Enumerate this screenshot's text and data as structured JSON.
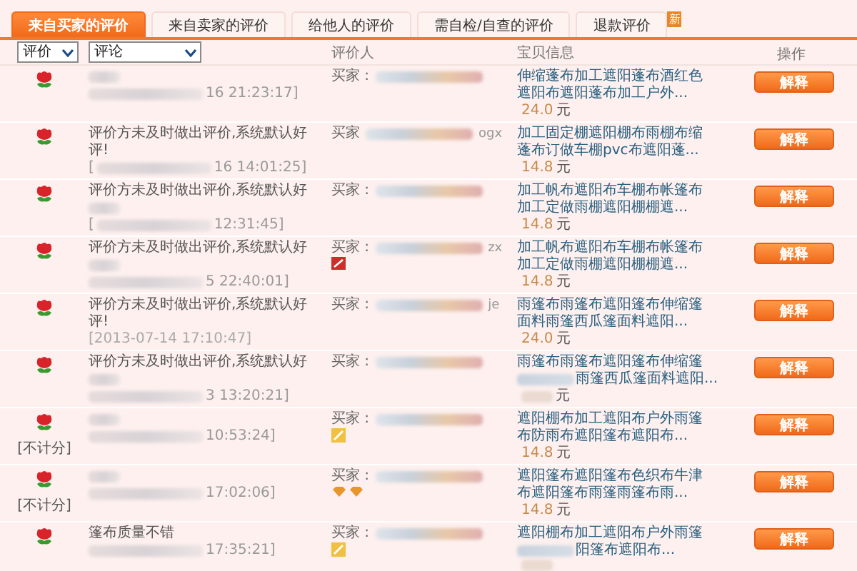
{
  "tabs": [
    {
      "label": "来自买家的评价",
      "selected": true
    },
    {
      "label": "来自卖家的评价",
      "selected": false
    },
    {
      "label": "给他人的评价",
      "selected": false
    },
    {
      "label": "需自检/自查的评价",
      "selected": false
    },
    {
      "label": "退款评价",
      "selected": false,
      "badge": "新"
    }
  ],
  "filters": [
    {
      "value": "评价"
    },
    {
      "value": "评论"
    }
  ],
  "columns": [
    "评价人",
    "宝贝信息",
    "操作"
  ],
  "rows": [
    {
      "comment_blurred": true,
      "time": "16 21:23:17]",
      "buyer_label": "买家 :",
      "item_lines": [
        {
          "text": "伸缩蓬布加工遮阳蓬布酒红色"
        },
        {
          "text": "遮阳布遮阳蓬布加工户外..."
        }
      ],
      "price": "24.0",
      "currency": "元",
      "action": "解释"
    },
    {
      "comment": "评价方未及时做出评价,系统默认好评!",
      "time_lead": "[",
      "time": "16 14:01:25]",
      "buyer_label": "买家",
      "buyer_visible": "ogx",
      "item_lines": [
        {
          "text": "加工固定棚遮阳棚布雨棚布缩"
        },
        {
          "text": "蓬布订做车棚pvc布遮阳蓬..."
        }
      ],
      "price": "14.8",
      "currency": "元",
      "action": "解释"
    },
    {
      "comment": "评价方未及时做出评价,系统默认好",
      "comment_blurred": true,
      "time_lead": "[",
      "time": "12:31:45]",
      "buyer_label": "买家 :",
      "item_lines": [
        {
          "text": "加工帆布遮阳布车棚布帐篷布"
        },
        {
          "text": "加工定做雨棚遮阳棚棚遮..."
        }
      ],
      "price": "14.8",
      "currency": "元",
      "action": "解释"
    },
    {
      "comment": "评价方未及时做出评价,系统默认好",
      "comment_blurred": true,
      "time": "5 22:40:01]",
      "buyer_label": "买家 :",
      "buyer_visible": "zx",
      "badge": {
        "kind": "flag"
      },
      "item_lines": [
        {
          "text": "加工帆布遮阳布车棚布帐篷布"
        },
        {
          "text": "加工定做雨棚遮阳棚棚遮..."
        }
      ],
      "price": "14.8",
      "currency": "元",
      "action": "解释"
    },
    {
      "comment": "评价方未及时做出评价,系统默认好评!",
      "time": "[2013-07-14 17:10:47]",
      "time_full": true,
      "buyer_label": "买家 :",
      "buyer_visible": "je",
      "item_lines": [
        {
          "text": "雨篷布雨篷布遮阳篷布伸缩篷"
        },
        {
          "text": "面料雨篷西瓜篷面料遮阳..."
        }
      ],
      "price": "24.0",
      "currency": "元",
      "action": "解释"
    },
    {
      "comment": "评价方未及时做出评价,系统默认好",
      "comment_blurred": true,
      "time": "3 13:20:21]",
      "buyer_label": "买家 :",
      "item_lines": [
        {
          "text": "雨篷布雨篷布遮阳篷布伸缩篷"
        },
        {
          "text": "雨篷西瓜篷面料遮阳...",
          "blurred_lead": true
        }
      ],
      "price_blurred": true,
      "currency": "元",
      "action": "解释"
    },
    {
      "note": "[不计分]",
      "comment_blurred": true,
      "time": "10:53:24]",
      "buyer_label": "买家 :",
      "badge": {
        "kind": "vip"
      },
      "item_lines": [
        {
          "text": "遮阳棚布加工遮阳布户外雨篷"
        },
        {
          "text": "布防雨布遮阳篷布遮阳布..."
        }
      ],
      "price": "14.8",
      "currency": "元",
      "action": "解释"
    },
    {
      "note": "[不计分]",
      "comment_blurred": true,
      "time": "17:02:06]",
      "buyer_label": "买家 :",
      "badge": {
        "kind": "diamonds"
      },
      "item_lines": [
        {
          "text": "遮阳篷布遮阳篷布色织布牛津"
        },
        {
          "text": "布遮阳篷布雨篷雨篷布雨..."
        }
      ],
      "price": "14.8",
      "currency": "元",
      "action": "解释"
    },
    {
      "comment": "篷布质量不错",
      "time": "17:35:21]",
      "buyer_label": "买家 :",
      "badge": {
        "kind": "vip"
      },
      "item_lines": [
        {
          "text": "遮阳棚布加工遮阳布户外雨篷"
        },
        {
          "text": "阳篷布遮阳布...",
          "blurred_lead": true
        }
      ],
      "price_blurred": true,
      "action": "解释"
    }
  ]
}
